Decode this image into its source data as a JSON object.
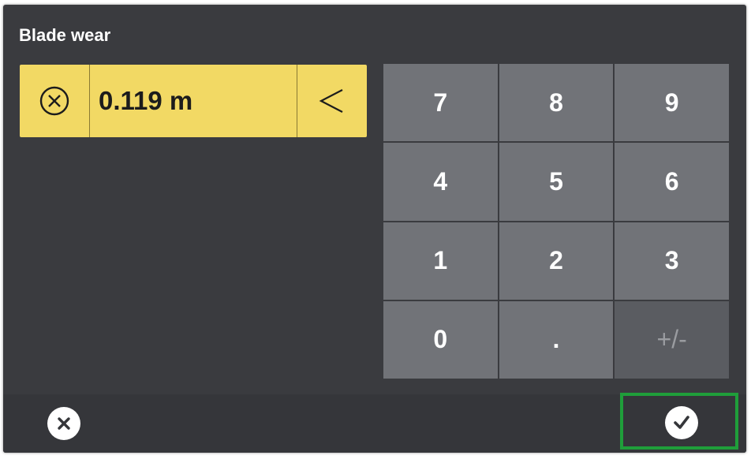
{
  "dialog": {
    "title": "Blade wear"
  },
  "input": {
    "value": "0.119 m",
    "clear_icon": "circle-x-icon",
    "backspace_icon": "chevron-left-icon"
  },
  "keypad": {
    "keys": [
      "7",
      "8",
      "9",
      "4",
      "5",
      "6",
      "1",
      "2",
      "3",
      "0",
      ".",
      "+/-"
    ]
  },
  "footer": {
    "cancel_icon": "close-icon",
    "confirm_icon": "check-icon"
  },
  "colors": {
    "accent": "#f2d964",
    "background": "#3a3b3f",
    "key": "#717378",
    "highlight": "#1f9e3a"
  }
}
